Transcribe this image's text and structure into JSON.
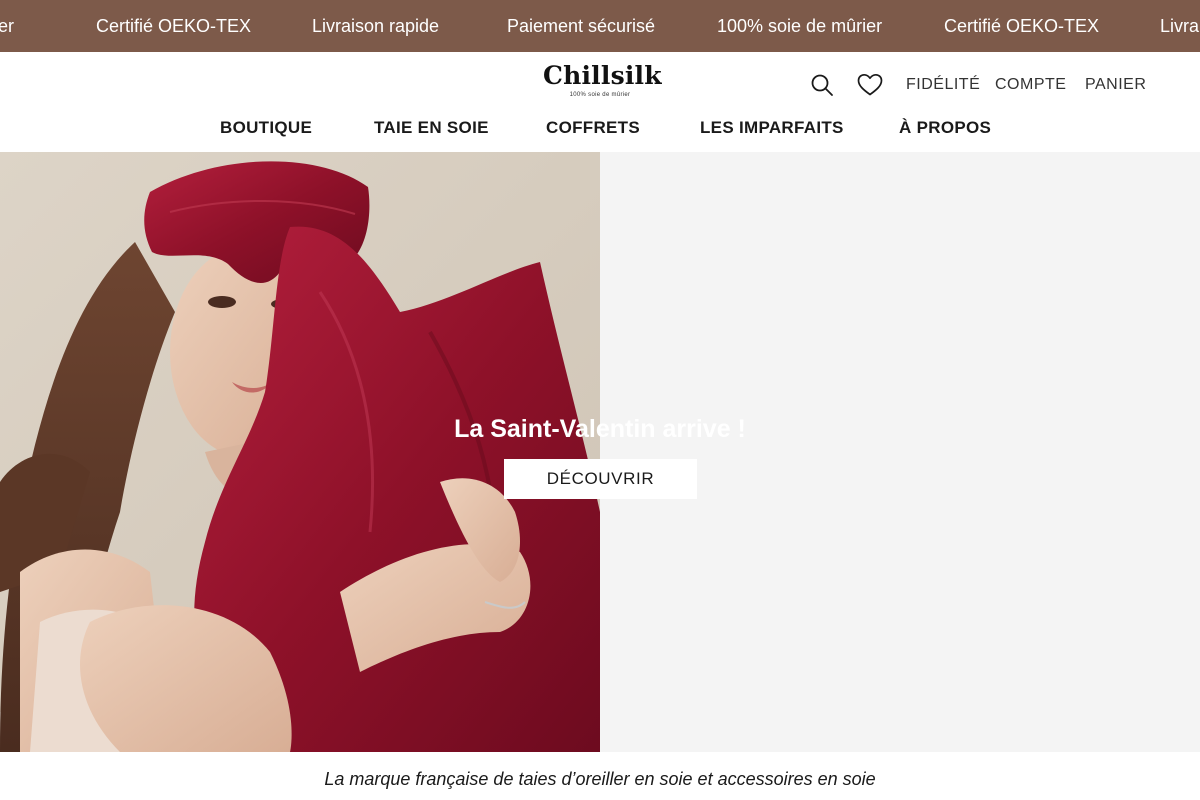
{
  "announcement": {
    "items": [
      "rier",
      "Certifié OEKO-TEX",
      "Livraison rapide",
      "Paiement sécurisé",
      "100% soie de mûrier",
      "Certifié OEKO-TEX",
      "Livra"
    ],
    "background_color": "#7d5a4a"
  },
  "header": {
    "logo": {
      "wordmark": "Chillsilk",
      "tagline": "100% soie de mûrier"
    },
    "icons": {
      "search": "search-icon",
      "wishlist": "heart-icon"
    },
    "utility_links": {
      "fidelite": "Fidélité",
      "compte": "Compte",
      "panier": "Panier"
    },
    "nav": [
      "Boutique",
      "Taie en soie",
      "Coffrets",
      "Les Imparfaits",
      "À propos"
    ]
  },
  "hero": {
    "title": "La Saint-Valentin arrive !",
    "cta_label": "Découvrir",
    "accent_color": "#9b1530"
  },
  "tagline": "La marque française de taies d’oreiller en soie et accessoires en soie"
}
